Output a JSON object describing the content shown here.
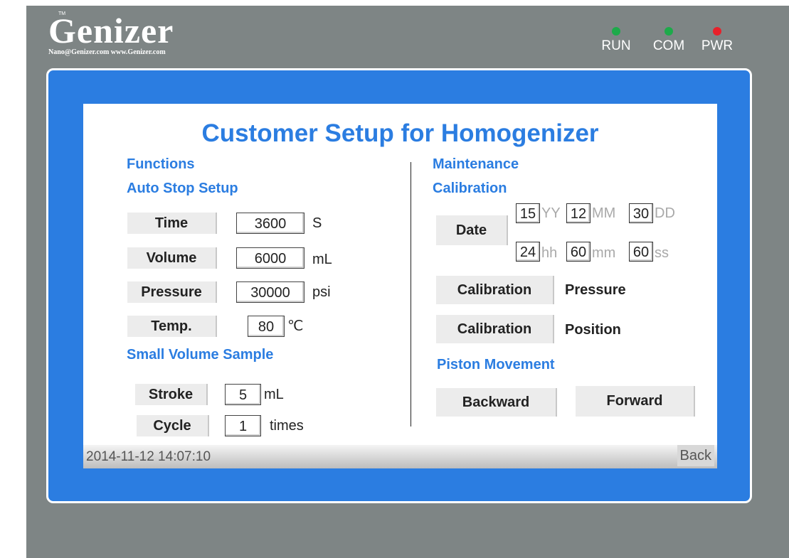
{
  "brand": {
    "name": "Genizer",
    "tm": "TM",
    "contact": "Nano@Genizer.com  www.Genizer.com"
  },
  "indicators": [
    {
      "label": "RUN",
      "color": "#1daa4a"
    },
    {
      "label": "COM",
      "color": "#1daa4a"
    },
    {
      "label": "PWR",
      "color": "#e8202a"
    }
  ],
  "colors": {
    "accent": "#2b7de1",
    "frame": "#7e8585"
  },
  "title": "Customer Setup for Homogenizer",
  "left": {
    "functions_label": "Functions",
    "auto_stop_label": "Auto Stop Setup",
    "auto_stop": [
      {
        "button": "Time",
        "value": "3600",
        "unit": "S"
      },
      {
        "button": "Volume",
        "value": "6000",
        "unit": "mL"
      },
      {
        "button": "Pressure",
        "value": "30000",
        "unit": "psi"
      },
      {
        "button": "Temp.",
        "value": "80",
        "unit": "℃"
      }
    ],
    "small_volume_label": "Small Volume Sample",
    "small_volume": [
      {
        "button": "Stroke",
        "value": "5",
        "unit": "mL"
      },
      {
        "button": "Cycle",
        "value": "1",
        "unit": "times"
      }
    ]
  },
  "right": {
    "maintenance_label": "Maintenance",
    "calibration_label": "Calibration",
    "date_button": "Date",
    "date": [
      {
        "value": "15",
        "unit": "YY"
      },
      {
        "value": "12",
        "unit": "MM"
      },
      {
        "value": "30",
        "unit": "DD"
      }
    ],
    "time": [
      {
        "value": "24",
        "unit": "hh"
      },
      {
        "value": "60",
        "unit": "mm"
      },
      {
        "value": "60",
        "unit": "ss"
      }
    ],
    "calibrations": [
      {
        "button": "Calibration",
        "label": "Pressure"
      },
      {
        "button": "Calibration",
        "label": "Position"
      }
    ],
    "piston_label": "Piston Movement",
    "piston_backward": "Backward",
    "piston_forward": "Forward"
  },
  "status": {
    "datetime": "2014-11-12 14:07:10",
    "back": "Back"
  }
}
